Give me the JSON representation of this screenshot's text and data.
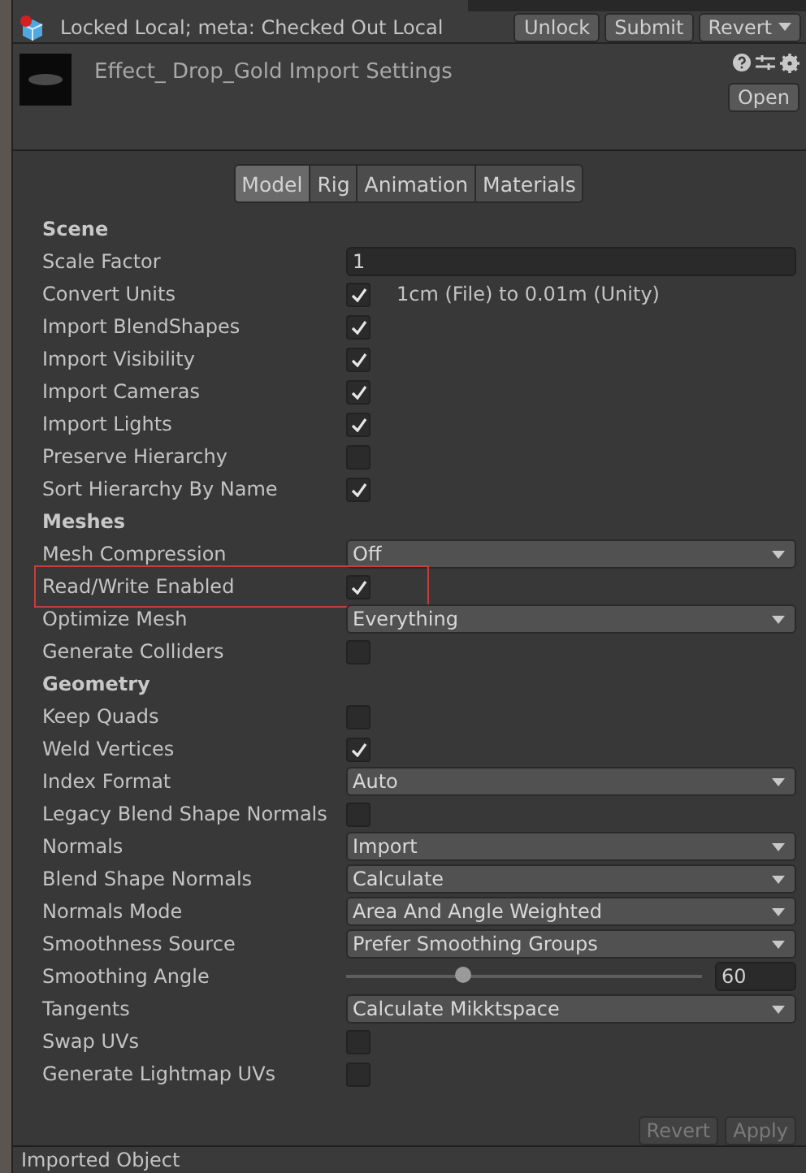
{
  "vcs_bar": {
    "status": "Locked Local; meta: Checked Out Local",
    "buttons": [
      "Unlock",
      "Submit"
    ],
    "revert": "Revert"
  },
  "header": {
    "title": "Effect_ Drop_Gold Import Settings",
    "open_button": "Open"
  },
  "tabs": [
    {
      "label": "Model",
      "selected": true
    },
    {
      "label": "Rig",
      "selected": false
    },
    {
      "label": "Animation",
      "selected": false
    },
    {
      "label": "Materials",
      "selected": false
    }
  ],
  "rows": [
    {
      "kind": "header",
      "label": "Scene"
    },
    {
      "kind": "text",
      "label": "Scale Factor",
      "value": "1"
    },
    {
      "kind": "checkbox",
      "label": "Convert Units",
      "checked": true,
      "note": "1cm (File) to 0.01m (Unity)"
    },
    {
      "kind": "checkbox",
      "label": "Import BlendShapes",
      "checked": true
    },
    {
      "kind": "checkbox",
      "label": "Import Visibility",
      "checked": true
    },
    {
      "kind": "checkbox",
      "label": "Import Cameras",
      "checked": true
    },
    {
      "kind": "checkbox",
      "label": "Import Lights",
      "checked": true
    },
    {
      "kind": "checkbox",
      "label": "Preserve Hierarchy",
      "checked": false
    },
    {
      "kind": "checkbox",
      "label": "Sort Hierarchy By Name",
      "checked": true
    },
    {
      "kind": "header",
      "label": "Meshes"
    },
    {
      "kind": "dropdown",
      "label": "Mesh Compression",
      "value": "Off"
    },
    {
      "kind": "checkbox",
      "label": "Read/Write Enabled",
      "checked": true,
      "highlighted": true
    },
    {
      "kind": "dropdown",
      "label": "Optimize Mesh",
      "value": "Everything"
    },
    {
      "kind": "checkbox",
      "label": "Generate Colliders",
      "checked": false
    },
    {
      "kind": "header",
      "label": "Geometry"
    },
    {
      "kind": "checkbox",
      "label": "Keep Quads",
      "checked": false
    },
    {
      "kind": "checkbox",
      "label": "Weld Vertices",
      "checked": true
    },
    {
      "kind": "dropdown",
      "label": "Index Format",
      "value": "Auto"
    },
    {
      "kind": "checkbox",
      "label": "Legacy Blend Shape Normals",
      "checked": false
    },
    {
      "kind": "dropdown",
      "label": "Normals",
      "value": "Import"
    },
    {
      "kind": "dropdown",
      "label": "Blend Shape Normals",
      "value": "Calculate"
    },
    {
      "kind": "dropdown",
      "label": "Normals Mode",
      "value": "Area And Angle Weighted"
    },
    {
      "kind": "dropdown",
      "label": "Smoothness Source",
      "value": "Prefer Smoothing Groups"
    },
    {
      "kind": "slider",
      "label": "Smoothing Angle",
      "level": 0.33,
      "value": "60"
    },
    {
      "kind": "dropdown",
      "label": "Tangents",
      "value": "Calculate Mikktspace"
    },
    {
      "kind": "checkbox",
      "label": "Swap UVs",
      "checked": false
    },
    {
      "kind": "checkbox",
      "label": "Generate Lightmap UVs",
      "checked": false
    }
  ],
  "actions": {
    "revert": "Revert",
    "apply": "Apply",
    "disabled": true
  },
  "footer": {
    "title": "Imported Object"
  }
}
